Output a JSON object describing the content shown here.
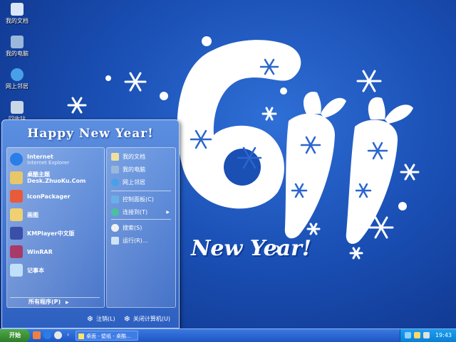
{
  "desktop_icons": [
    {
      "label": "我的文档",
      "icon": "documents-folder-icon",
      "color": "#d8e6f8"
    },
    {
      "label": "我的电脑",
      "icon": "computer-icon",
      "color": "#9ab8dc"
    },
    {
      "label": "网上邻居",
      "icon": "network-icon",
      "color": "#4aa0e8"
    },
    {
      "label": "回收站",
      "icon": "recycle-bin-icon",
      "color": "#c9d6e6"
    }
  ],
  "wallpaper": {
    "text": "New Year!",
    "colors": {
      "background": "#1a4fb4",
      "art": "#ffffff"
    }
  },
  "start_menu": {
    "banner": "Happy New Year!",
    "programs": [
      {
        "title": "Internet",
        "subtitle": "Internet Explorer",
        "icon": "internet-explorer-icon",
        "color": "#2a7ee8"
      },
      {
        "title": "桌酷主题Desk.ZhuoKu.Com",
        "subtitle": "",
        "icon": "zhuoku-theme-icon",
        "color": "#e8c66a"
      },
      {
        "title": "IconPackager",
        "subtitle": "",
        "icon": "iconpackager-icon",
        "color": "#e85a3a"
      },
      {
        "title": "画图",
        "subtitle": "",
        "icon": "paint-icon",
        "color": "#f0d070"
      },
      {
        "title": "KMPlayer中文版",
        "subtitle": "",
        "icon": "kmplayer-icon",
        "color": "#3a4fa8"
      },
      {
        "title": "WinRAR",
        "subtitle": "",
        "icon": "winrar-icon",
        "color": "#a83a6a"
      },
      {
        "title": "记事本",
        "subtitle": "",
        "icon": "notepad-icon",
        "color": "#bfe0f8"
      }
    ],
    "all_programs": "所有程序(P)",
    "places": [
      {
        "label": "我的文档",
        "icon": "documents-folder-icon",
        "color": "#f0e0a0"
      },
      {
        "label": "我的电脑",
        "icon": "computer-icon",
        "color": "#9ab8dc"
      },
      {
        "label": "网上邻居",
        "icon": "network-icon",
        "color": "#4aa0e8"
      }
    ],
    "tools": [
      {
        "label": "控制面板(C)",
        "icon": "control-panel-icon",
        "color": "#6ab0e8",
        "arrow": ""
      },
      {
        "label": "连接到(T)",
        "icon": "connect-icon",
        "color": "#4ac0a0",
        "arrow": "▶"
      }
    ],
    "actions": [
      {
        "label": "搜索(S)",
        "icon": "search-icon",
        "color": "#f0f0f0"
      },
      {
        "label": "运行(R)...",
        "icon": "run-icon",
        "color": "#d0e4f8"
      }
    ],
    "logoff": "注销(L)",
    "shutdown": "关闭计算机(U)"
  },
  "taskbar": {
    "start_label": "开始",
    "task_label": "桌面 - 壁纸 - 桌酷...",
    "time": "19:43",
    "colors": {
      "bar": "#1e56c4",
      "tray": "#0b7ed6",
      "start": "#2e7d28"
    }
  }
}
